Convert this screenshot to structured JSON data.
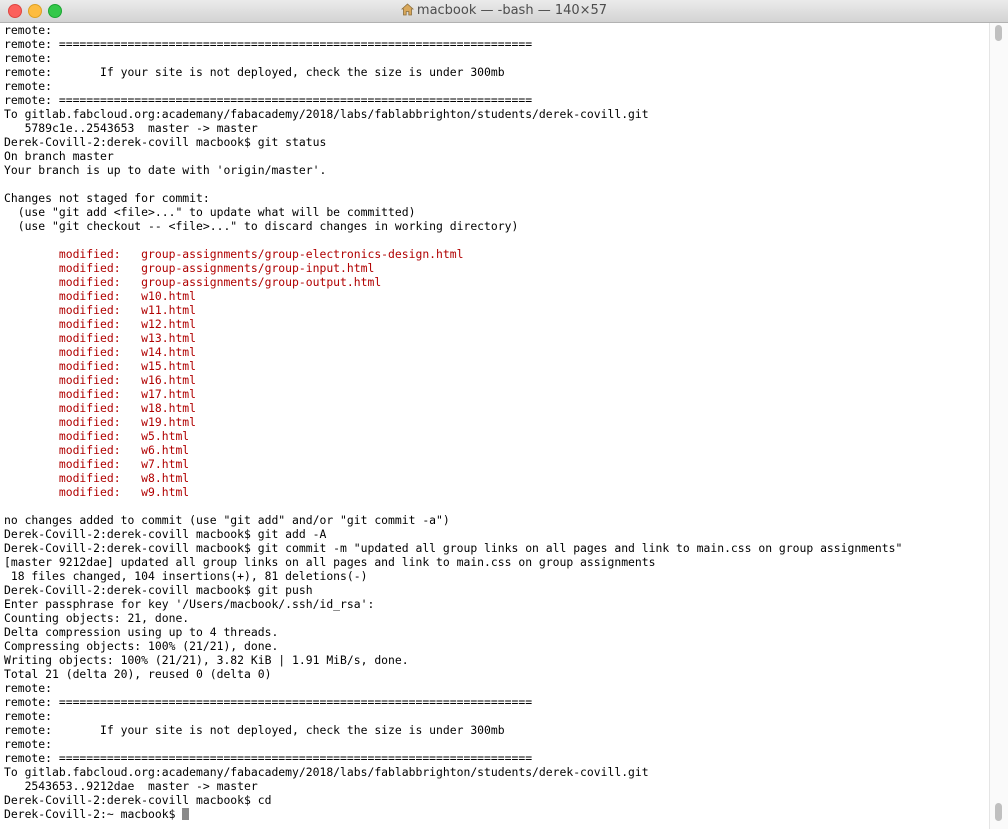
{
  "window": {
    "title": "macbook — -bash — 140×57",
    "home_icon": "home-icon"
  },
  "terminal": {
    "colors": {
      "text": "#000000",
      "modified": "#b00000",
      "background": "#ffffff"
    },
    "lines": [
      {
        "text": "remote:"
      },
      {
        "text": "remote: ====================================================================="
      },
      {
        "text": "remote:"
      },
      {
        "text": "remote:       If your site is not deployed, check the size is under 300mb"
      },
      {
        "text": "remote:"
      },
      {
        "text": "remote: ====================================================================="
      },
      {
        "text": "To gitlab.fabcloud.org:academany/fabacademy/2018/labs/fablabbrighton/students/derek-covill.git"
      },
      {
        "text": "   5789c1e..2543653  master -> master"
      },
      {
        "text": "Derek-Covill-2:derek-covill macbook$ git status"
      },
      {
        "text": "On branch master"
      },
      {
        "text": "Your branch is up to date with 'origin/master'."
      },
      {
        "text": ""
      },
      {
        "text": "Changes not staged for commit:"
      },
      {
        "text": "  (use \"git add <file>...\" to update what will be committed)"
      },
      {
        "text": "  (use \"git checkout -- <file>...\" to discard changes in working directory)"
      },
      {
        "text": ""
      },
      {
        "text": "        modified:   group-assignments/group-electronics-design.html",
        "cls": "mod"
      },
      {
        "text": "        modified:   group-assignments/group-input.html",
        "cls": "mod"
      },
      {
        "text": "        modified:   group-assignments/group-output.html",
        "cls": "mod"
      },
      {
        "text": "        modified:   w10.html",
        "cls": "mod"
      },
      {
        "text": "        modified:   w11.html",
        "cls": "mod"
      },
      {
        "text": "        modified:   w12.html",
        "cls": "mod"
      },
      {
        "text": "        modified:   w13.html",
        "cls": "mod"
      },
      {
        "text": "        modified:   w14.html",
        "cls": "mod"
      },
      {
        "text": "        modified:   w15.html",
        "cls": "mod"
      },
      {
        "text": "        modified:   w16.html",
        "cls": "mod"
      },
      {
        "text": "        modified:   w17.html",
        "cls": "mod"
      },
      {
        "text": "        modified:   w18.html",
        "cls": "mod"
      },
      {
        "text": "        modified:   w19.html",
        "cls": "mod"
      },
      {
        "text": "        modified:   w5.html",
        "cls": "mod"
      },
      {
        "text": "        modified:   w6.html",
        "cls": "mod"
      },
      {
        "text": "        modified:   w7.html",
        "cls": "mod"
      },
      {
        "text": "        modified:   w8.html",
        "cls": "mod"
      },
      {
        "text": "        modified:   w9.html",
        "cls": "mod"
      },
      {
        "text": ""
      },
      {
        "text": "no changes added to commit (use \"git add\" and/or \"git commit -a\")"
      },
      {
        "text": "Derek-Covill-2:derek-covill macbook$ git add -A"
      },
      {
        "text": "Derek-Covill-2:derek-covill macbook$ git commit -m \"updated all group links on all pages and link to main.css on group assignments\""
      },
      {
        "text": "[master 9212dae] updated all group links on all pages and link to main.css on group assignments"
      },
      {
        "text": " 18 files changed, 104 insertions(+), 81 deletions(-)"
      },
      {
        "text": "Derek-Covill-2:derek-covill macbook$ git push"
      },
      {
        "text": "Enter passphrase for key '/Users/macbook/.ssh/id_rsa':"
      },
      {
        "text": "Counting objects: 21, done."
      },
      {
        "text": "Delta compression using up to 4 threads."
      },
      {
        "text": "Compressing objects: 100% (21/21), done."
      },
      {
        "text": "Writing objects: 100% (21/21), 3.82 KiB | 1.91 MiB/s, done."
      },
      {
        "text": "Total 21 (delta 20), reused 0 (delta 0)"
      },
      {
        "text": "remote:"
      },
      {
        "text": "remote: ====================================================================="
      },
      {
        "text": "remote:"
      },
      {
        "text": "remote:       If your site is not deployed, check the size is under 300mb"
      },
      {
        "text": "remote:"
      },
      {
        "text": "remote: ====================================================================="
      },
      {
        "text": "To gitlab.fabcloud.org:academany/fabacademy/2018/labs/fablabbrighton/students/derek-covill.git"
      },
      {
        "text": "   2543653..9212dae  master -> master"
      },
      {
        "text": "Derek-Covill-2:derek-covill macbook$ cd"
      },
      {
        "text": "Derek-Covill-2:~ macbook$ ",
        "cursor": true
      }
    ]
  }
}
